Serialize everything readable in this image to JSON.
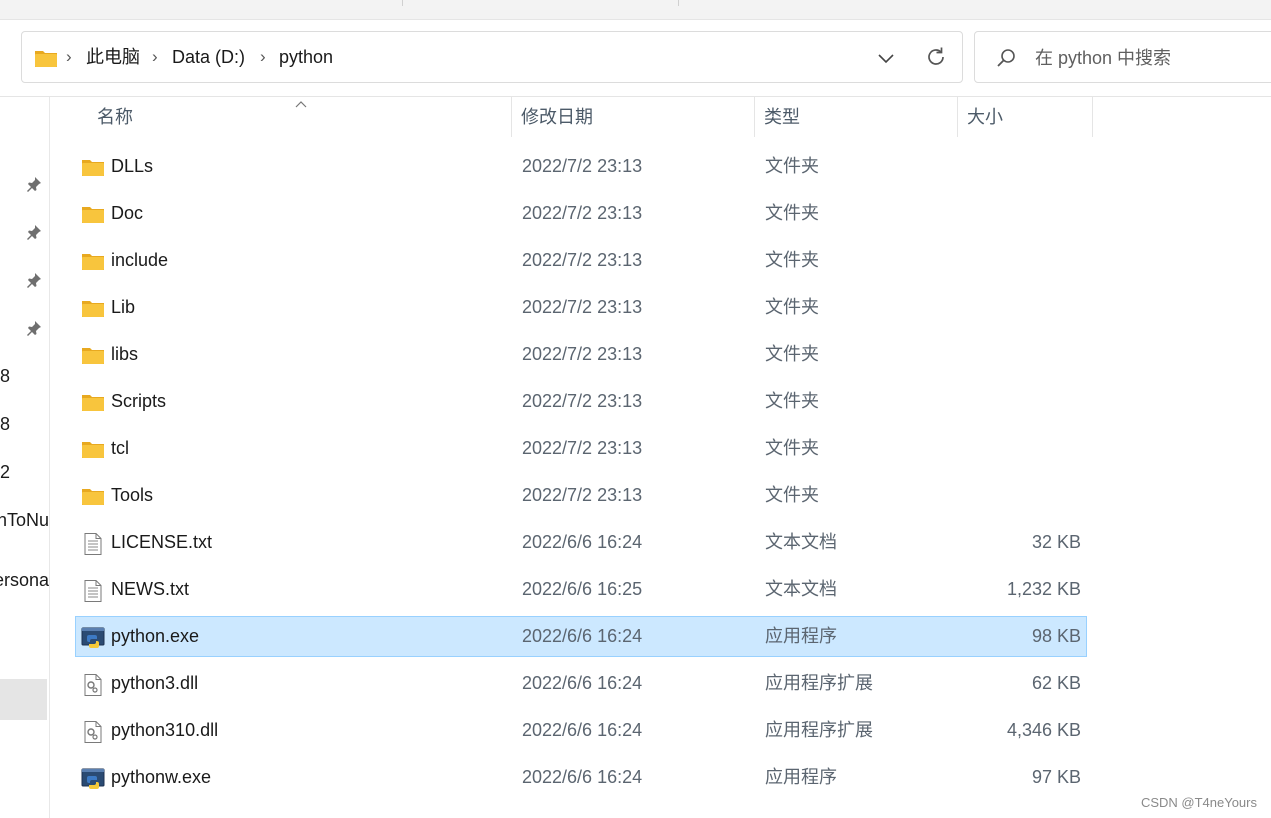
{
  "window": {
    "breadcrumb": [
      "此电脑",
      "Data (D:)",
      "python"
    ],
    "search_placeholder": "在 python 中搜索"
  },
  "nav_fragments": [
    "8",
    "8",
    "2",
    "nToNu",
    "ersona"
  ],
  "columns": {
    "name": "名称",
    "date": "修改日期",
    "type": "类型",
    "size": "大小"
  },
  "files": [
    {
      "name": "DLLs",
      "date": "2022/7/2 23:13",
      "type": "文件夹",
      "size": "",
      "icon": "folder-icon"
    },
    {
      "name": "Doc",
      "date": "2022/7/2 23:13",
      "type": "文件夹",
      "size": "",
      "icon": "folder-icon"
    },
    {
      "name": "include",
      "date": "2022/7/2 23:13",
      "type": "文件夹",
      "size": "",
      "icon": "folder-icon"
    },
    {
      "name": "Lib",
      "date": "2022/7/2 23:13",
      "type": "文件夹",
      "size": "",
      "icon": "folder-icon"
    },
    {
      "name": "libs",
      "date": "2022/7/2 23:13",
      "type": "文件夹",
      "size": "",
      "icon": "folder-icon"
    },
    {
      "name": "Scripts",
      "date": "2022/7/2 23:13",
      "type": "文件夹",
      "size": "",
      "icon": "folder-icon"
    },
    {
      "name": "tcl",
      "date": "2022/7/2 23:13",
      "type": "文件夹",
      "size": "",
      "icon": "folder-icon"
    },
    {
      "name": "Tools",
      "date": "2022/7/2 23:13",
      "type": "文件夹",
      "size": "",
      "icon": "folder-icon"
    },
    {
      "name": "LICENSE.txt",
      "date": "2022/6/6 16:24",
      "type": "文本文档",
      "size": "32 KB",
      "icon": "text-file-icon"
    },
    {
      "name": "NEWS.txt",
      "date": "2022/6/6 16:25",
      "type": "文本文档",
      "size": "1,232 KB",
      "icon": "text-file-icon"
    },
    {
      "name": "python.exe",
      "date": "2022/6/6 16:24",
      "type": "应用程序",
      "size": "98 KB",
      "icon": "python-exe-icon",
      "selected": true
    },
    {
      "name": "python3.dll",
      "date": "2022/6/6 16:24",
      "type": "应用程序扩展",
      "size": "62 KB",
      "icon": "dll-file-icon"
    },
    {
      "name": "python310.dll",
      "date": "2022/6/6 16:24",
      "type": "应用程序扩展",
      "size": "4,346 KB",
      "icon": "dll-file-icon"
    },
    {
      "name": "pythonw.exe",
      "date": "2022/6/6 16:24",
      "type": "应用程序",
      "size": "97 KB",
      "icon": "python-exe-icon"
    }
  ],
  "watermark": "CSDN @T4neYours",
  "colors": {
    "selection": "#cce8ff",
    "selection_border": "#99d1ff",
    "folder": "#f8c53d",
    "header_text": "#4c5a68"
  }
}
